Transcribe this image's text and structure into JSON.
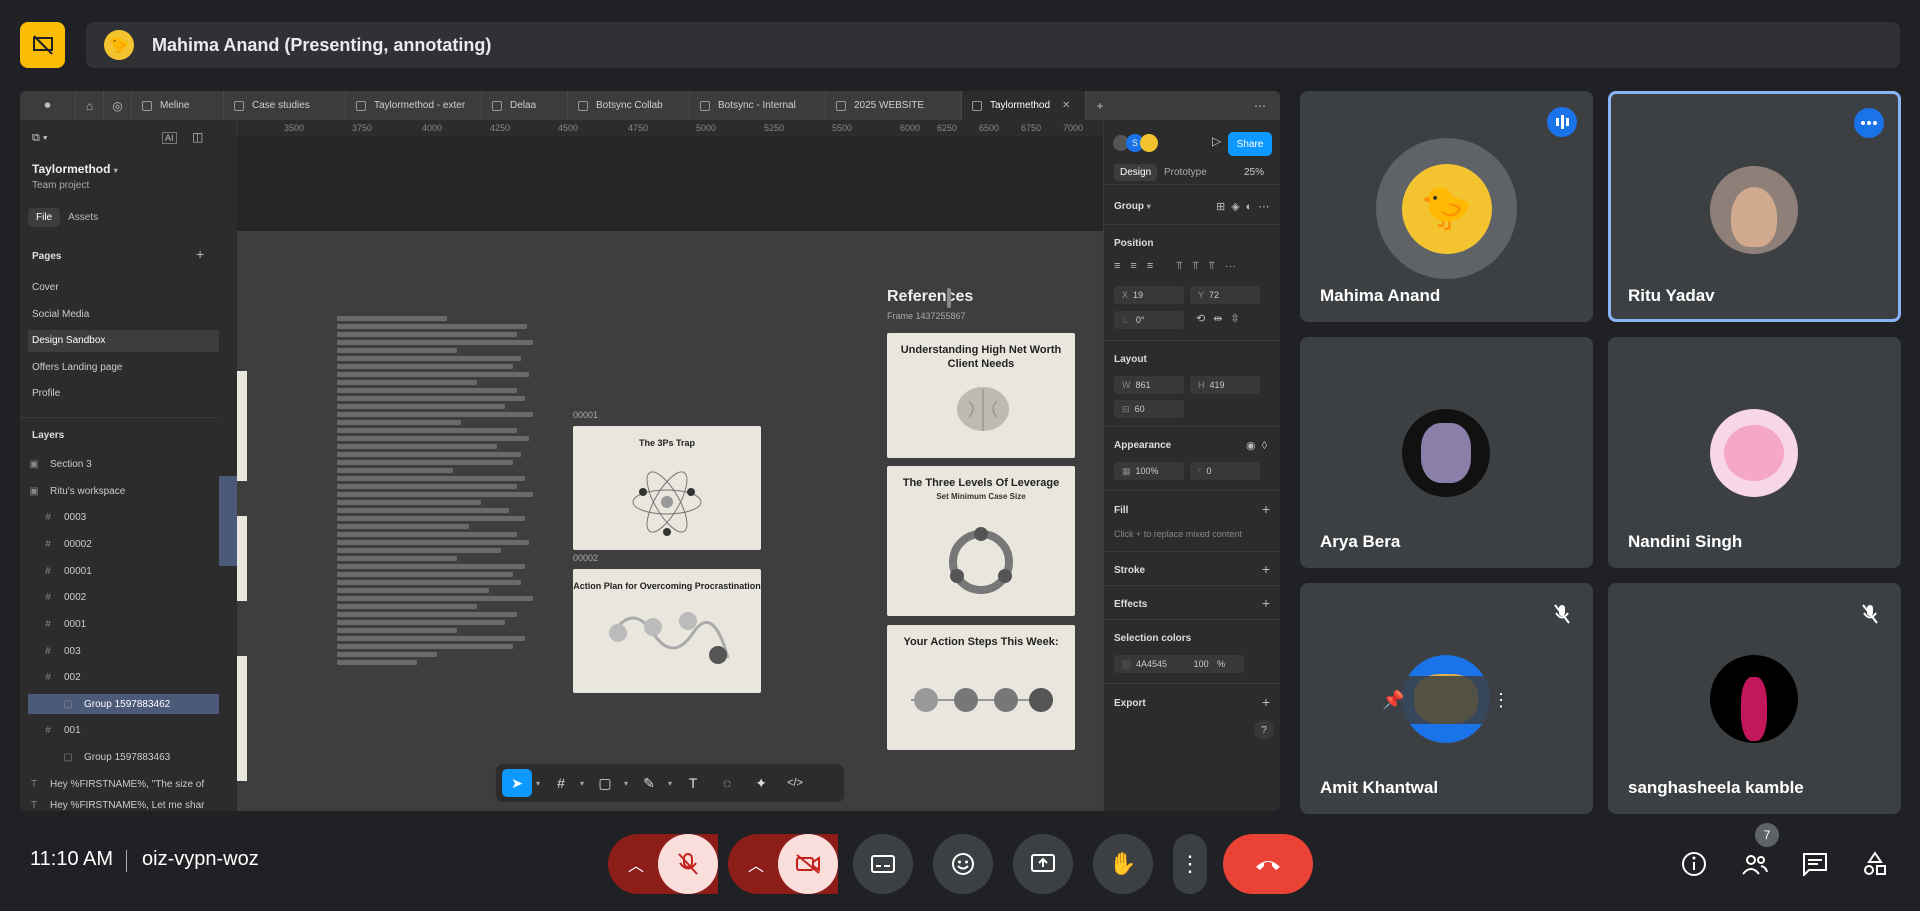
{
  "meet": {
    "presenter_banner": "Mahima Anand (Presenting, annotating)",
    "time": "11:10 AM",
    "meeting_code": "oiz-vypn-woz",
    "participant_count": "7"
  },
  "participants": [
    {
      "name": "Mahima Anand"
    },
    {
      "name": "Ritu Yadav"
    },
    {
      "name": "Arya Bera"
    },
    {
      "name": "Nandini Singh"
    },
    {
      "name": "Amit Khantwal"
    },
    {
      "name": "sanghasheela kamble"
    }
  ],
  "browser": {
    "tabs": [
      {
        "label": "Meline"
      },
      {
        "label": "Case studies"
      },
      {
        "label": "Taylormethod - exter"
      },
      {
        "label": "Delaa"
      },
      {
        "label": "Botsync Collab"
      },
      {
        "label": "Botsync - Internal"
      },
      {
        "label": "2025 WEBSITE"
      },
      {
        "label": "Taylormethod"
      }
    ]
  },
  "figma": {
    "project_name": "Taylormethod",
    "project_sub": "Team project",
    "tab_file": "File",
    "tab_assets": "Assets",
    "pages_header": "Pages",
    "pages": [
      "Cover",
      "Social Media",
      "Design Sandbox",
      "Offers Landing page",
      "Profile"
    ],
    "layers_header": "Layers",
    "layers": [
      {
        "name": "Section 3",
        "icon": "#"
      },
      {
        "name": "Ritu's workspace",
        "icon": "#"
      },
      {
        "name": "0003",
        "icon": "#"
      },
      {
        "name": "00002",
        "icon": "#"
      },
      {
        "name": "00001",
        "icon": "#"
      },
      {
        "name": "0002",
        "icon": "#"
      },
      {
        "name": "0001",
        "icon": "#"
      },
      {
        "name": "003",
        "icon": "#"
      },
      {
        "name": "002",
        "icon": "#"
      },
      {
        "name": "Group 1597883462",
        "icon": "▢"
      },
      {
        "name": "001",
        "icon": "#"
      },
      {
        "name": "Group 1597883463",
        "icon": "▢"
      },
      {
        "name": "Hey %FIRSTNAME%, \"The size of",
        "icon": "T"
      },
      {
        "name": "Hey %FIRSTNAME%, Let me shar",
        "icon": "T"
      }
    ],
    "ruler_ticks": [
      "3500",
      "3750",
      "4000",
      "4250",
      "4500",
      "4750",
      "5000",
      "5250",
      "5500",
      "6000",
      "6250",
      "6500",
      "6750",
      "7000"
    ],
    "canvas": {
      "frame1_label": "00001",
      "frame2_label": "00002",
      "card1_title": "The 3Ps Trap",
      "card2_title": "Action Plan for Overcoming Procrastination",
      "refs_title": "References",
      "refs_sub": "Frame 1437255867",
      "ref1_title": "Understanding High Net Worth Client Needs",
      "ref2_title": "The Three Levels Of Leverage",
      "ref2_sub": "Set Minimum Case Size",
      "ref3_title": "Your Action Steps This Week:"
    },
    "right": {
      "share": "Share",
      "tab_design": "Design",
      "tab_prototype": "Prototype",
      "zoom": "25%",
      "selection_type": "Group",
      "position_label": "Position",
      "x_label": "X",
      "x_value": "19",
      "y_label": "Y",
      "y_value": "72",
      "rotation": "0°",
      "layout_label": "Layout",
      "w_label": "W",
      "w_value": "861",
      "h_label": "H",
      "h_value": "419",
      "gap_value": "60",
      "appearance_label": "Appearance",
      "opacity": "100%",
      "radius": "0",
      "fill_label": "Fill",
      "fill_hint": "Click + to replace mixed content",
      "stroke_label": "Stroke",
      "effects_label": "Effects",
      "selection_colors_label": "Selection colors",
      "sel_color_hex": "4A4545",
      "sel_color_opacity": "100",
      "sel_color_pct": "%",
      "export_label": "Export",
      "help": "?"
    }
  },
  "colors": {
    "meet_bg": "#202124",
    "tile_bg": "#3c4043",
    "active_border": "#8ab4f8",
    "present_yellow": "#fbbc04",
    "end_call_red": "#ea4335",
    "figma_blue": "#0d99ff"
  }
}
